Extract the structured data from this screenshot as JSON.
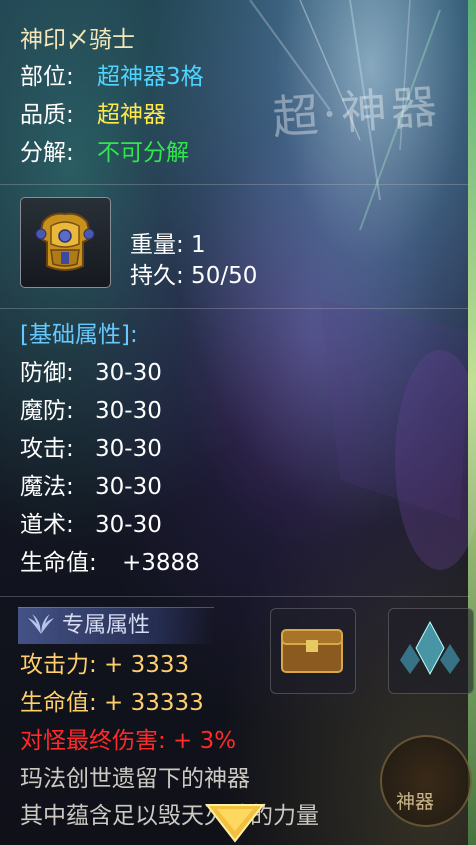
{
  "item": {
    "name": "神印〆骑士",
    "slot_label": "部位:",
    "slot_value": "超神器3格",
    "quality_label": "品质:",
    "quality_value": "超神器",
    "decompose_label": "分解:",
    "decompose_value": "不可分解",
    "weight_text": "重量: 1",
    "durability_text": "持久: 50/50",
    "icon": "golden-armor-icon"
  },
  "base_attributes": {
    "header": "[基础属性]:",
    "rows": [
      {
        "label": "防御:",
        "value": "30-30"
      },
      {
        "label": "魔防:",
        "value": "30-30"
      },
      {
        "label": "攻击:",
        "value": "30-30"
      },
      {
        "label": "魔法:",
        "value": "30-30"
      },
      {
        "label": "道术:",
        "value": "30-30"
      },
      {
        "label": "生命值:",
        "value": "+3888"
      }
    ]
  },
  "exclusive_attributes": {
    "header": "专属属性",
    "attack_text": "攻击力: + 3333",
    "hp_text": "生命值: + 33333",
    "damage_text": "对怪最终伤害: + 3%"
  },
  "description": {
    "line1": "玛法创世遗留下的神器",
    "line2": "其中蕴含足以毁天灭地的力量"
  },
  "background": {
    "watermark": "超·神器",
    "emblem": "神器"
  },
  "colors": {
    "title": "#f4e6b8",
    "slot": "#4fd4ff",
    "quality": "#ffe84a",
    "decompose": "#2ee84a",
    "base_header": "#66c8ff",
    "exclusive_stat": "#ffcf6a",
    "damage": "#ff2a2a"
  }
}
